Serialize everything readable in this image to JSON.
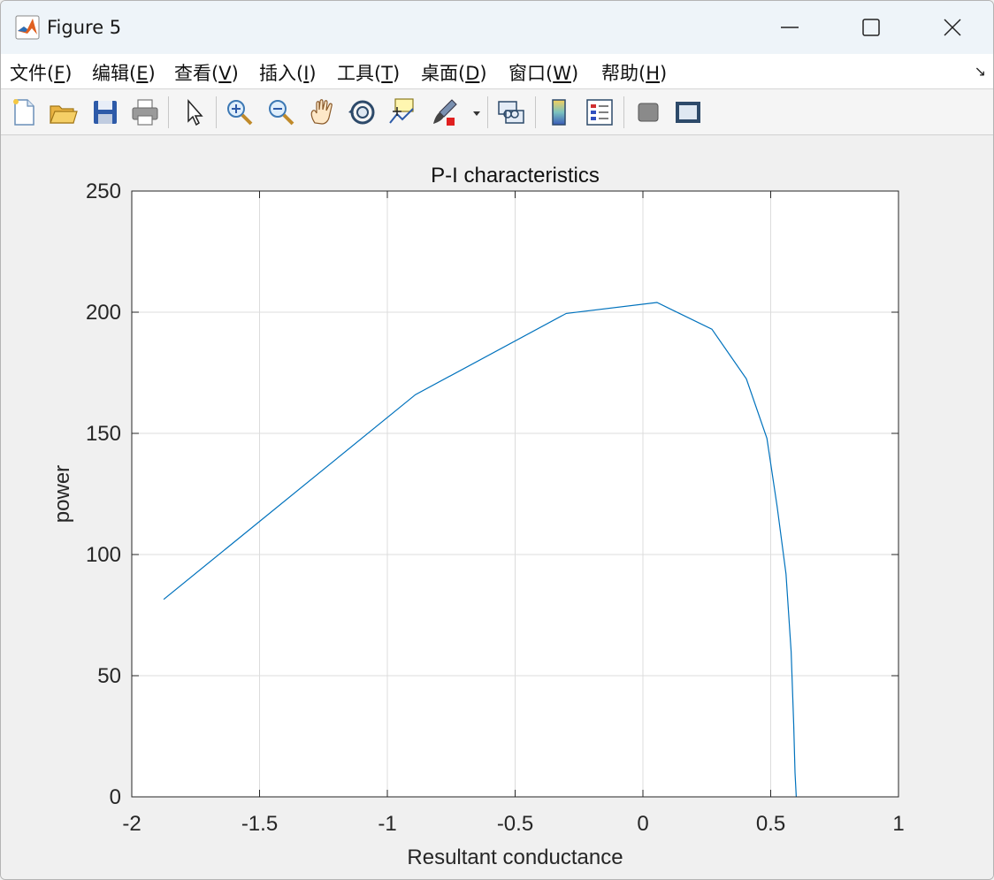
{
  "window": {
    "title": "Figure 5",
    "minimize_icon": "minimize-icon",
    "maximize_icon": "maximize-icon",
    "close_icon": "close-icon"
  },
  "menu": [
    {
      "label": "文件(",
      "key": "F",
      "end": ")"
    },
    {
      "label": "编辑(",
      "key": "E",
      "end": ")"
    },
    {
      "label": "查看(",
      "key": "V",
      "end": ")"
    },
    {
      "label": "插入(",
      "key": "I",
      "end": ")"
    },
    {
      "label": "工具(",
      "key": "T",
      "end": ")"
    },
    {
      "label": "桌面(",
      "key": "D",
      "end": ")"
    },
    {
      "label": "窗口(",
      "key": "W",
      "end": ")"
    },
    {
      "label": "帮助(",
      "key": "H",
      "end": ")"
    }
  ],
  "menu_expand_glyph": "↘",
  "toolbar": [
    "new-figure-icon",
    "open-file-icon",
    "save-icon",
    "print-icon",
    "pointer-icon",
    "zoom-in-icon",
    "zoom-out-icon",
    "pan-hand-icon",
    "rotate-3d-icon",
    "data-cursor-icon",
    "brush-icon",
    "link-plot-icon",
    "colorbar-icon",
    "legend-icon",
    "hide-plot-tools-icon",
    "show-plot-tools-icon"
  ],
  "chart_data": {
    "type": "line",
    "title": "P-I characteristics",
    "xlabel": "Resultant conductance",
    "ylabel": "power",
    "xlim": [
      -2,
      1
    ],
    "ylim": [
      0,
      250
    ],
    "xticks": [
      "-2",
      "-1.5",
      "-1",
      "-0.5",
      "0",
      "0.5",
      "1"
    ],
    "yticks": [
      "0",
      "50",
      "100",
      "150",
      "200",
      "250"
    ],
    "grid": true,
    "line_color": "#0072bd",
    "series": [
      {
        "x": [
          -1.875,
          -0.89,
          -0.3,
          0.055,
          0.27,
          0.405,
          0.485,
          0.525,
          0.56,
          0.58,
          0.59,
          0.595,
          0.6
        ],
        "y": [
          81.5,
          166,
          199.5,
          204,
          193,
          172.5,
          148,
          120,
          92,
          60,
          30,
          10,
          0
        ]
      }
    ]
  }
}
